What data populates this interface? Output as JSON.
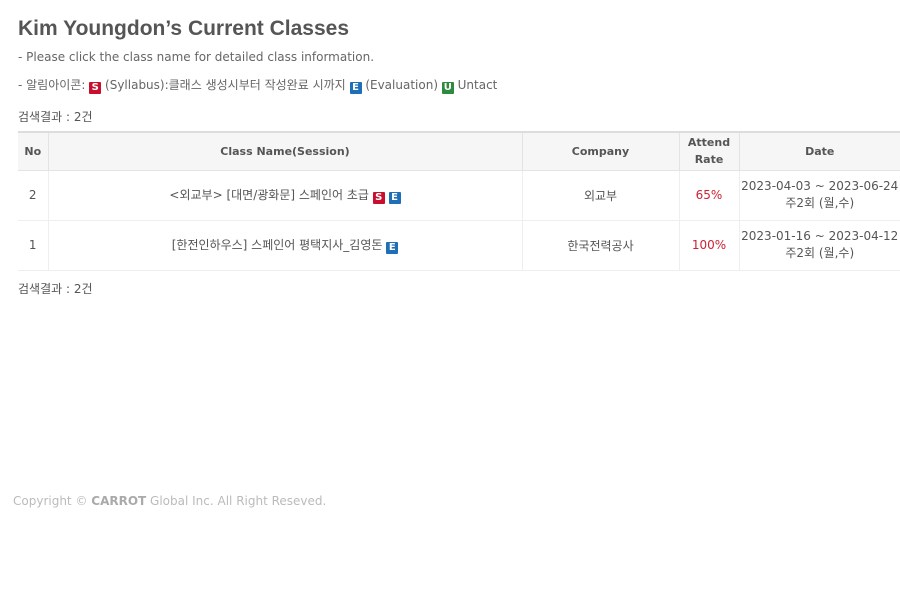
{
  "page": {
    "title": "Kim Youngdon’s Current Classes",
    "note_click": "- Please click the class name for detailed class information.",
    "legend": {
      "prefix": "- 알림아이콘: ",
      "s_badge": "S",
      "s_text": " (Syllabus):클래스 생성시부터 작성완료 시까지 ",
      "e_badge": "E",
      "e_text": " (Evaluation) ",
      "u_badge": "U",
      "u_text": " Untact"
    },
    "result_count": "검색결과 : 2건"
  },
  "table": {
    "headers": {
      "no": "No",
      "name": "Class Name(Session)",
      "company": "Company",
      "attend_line1": "Attend",
      "attend_line2": "Rate",
      "date": "Date"
    },
    "rows": [
      {
        "no": "2",
        "name": "<외교부> [대면/광화문] 스페인어 초급",
        "badges": [
          "S",
          "E"
        ],
        "company": "외교부",
        "rate": "65%",
        "date_range": "2023-04-03 ~ 2023-06-24",
        "schedule": "주2회 (월,수)"
      },
      {
        "no": "1",
        "name": "[한전인하우스] 스페인어 평택지사_김영돈",
        "badges": [
          "E"
        ],
        "company": "한국전력공사",
        "rate": "100%",
        "date_range": "2023-01-16 ~ 2023-04-12",
        "schedule": "주2회 (월,수)"
      }
    ]
  },
  "footer": {
    "copyright_prefix": "Copyright © ",
    "brand": "CARROT",
    "copyright_suffix": " Global Inc. All Right Reseved."
  },
  "colors": {
    "syllabus_badge": "#c8102e",
    "evaluation_badge": "#1f6fb8",
    "untact_badge": "#2e8b3d",
    "rate_text": "#cc2233"
  },
  "icons": {
    "syllabus": "syllabus-badge-icon",
    "evaluation": "evaluation-badge-icon",
    "untact": "untact-badge-icon"
  }
}
